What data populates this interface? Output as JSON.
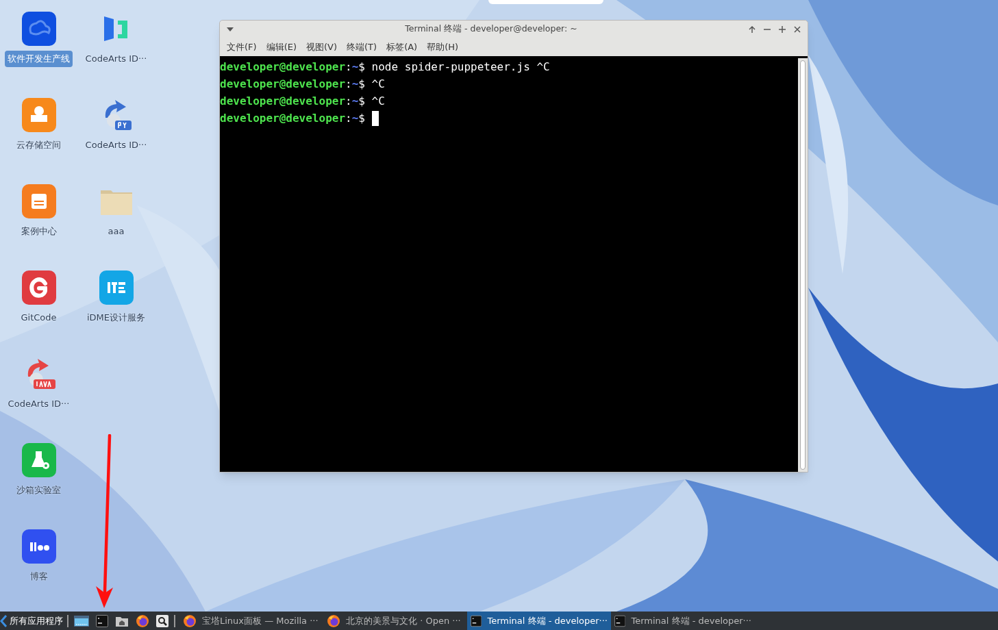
{
  "desktop": {
    "icons": [
      {
        "label": "软件开发生产线",
        "kind": "cloud",
        "selected": true
      },
      {
        "label": "云存储空间",
        "kind": "storage",
        "selected": false
      },
      {
        "label": "案例中心",
        "kind": "cases",
        "selected": false
      },
      {
        "label": "GitCode",
        "kind": "gitcode",
        "selected": false
      },
      {
        "label": "CodeArts ID···",
        "kind": "java",
        "selected": false
      },
      {
        "label": "沙箱实验室",
        "kind": "lab",
        "selected": false
      },
      {
        "label": "博客",
        "kind": "blog",
        "selected": false
      },
      {
        "label": "CodeArts ID···",
        "kind": "ide",
        "selected": false
      },
      {
        "label": "CodeArts ID···",
        "kind": "python",
        "selected": false
      },
      {
        "label": "aaa",
        "kind": "folder",
        "selected": false
      },
      {
        "label": "iDME设计服务",
        "kind": "idme",
        "selected": false
      }
    ]
  },
  "terminal_window": {
    "title": "Terminal 终端 - developer@developer: ~",
    "menu": [
      "文件(F)",
      "编辑(E)",
      "视图(V)",
      "终端(T)",
      "标签(A)",
      "帮助(H)"
    ],
    "lines": [
      {
        "user": "developer@developer",
        "separator": ":",
        "path": "~",
        "prompt": "$",
        "command": "node spider-puppeteer.js ^C"
      },
      {
        "user": "developer@developer",
        "separator": ":",
        "path": "~",
        "prompt": "$",
        "command": "^C"
      },
      {
        "user": "developer@developer",
        "separator": ":",
        "path": "~",
        "prompt": "$",
        "command": "^C"
      },
      {
        "user": "developer@developer",
        "separator": ":",
        "path": "~",
        "prompt": "$"
      }
    ]
  },
  "taskbar": {
    "start_label": "所有应用程序",
    "launchers": [
      {
        "kind": "screen"
      },
      {
        "kind": "terminal"
      },
      {
        "kind": "home"
      },
      {
        "kind": "browser"
      },
      {
        "kind": "search"
      }
    ],
    "tasks": [
      {
        "label": "宝塔Linux面板 — Mozilla ···",
        "kind": "browser",
        "selected": false
      },
      {
        "label": "北京的美景与文化 · Open ···",
        "kind": "browser",
        "selected": false
      },
      {
        "label": "Terminal 终端 - developer···",
        "kind": "terminal",
        "selected": true
      },
      {
        "label": "Terminal 终端 - developer···",
        "kind": "terminal",
        "selected": false
      }
    ]
  }
}
